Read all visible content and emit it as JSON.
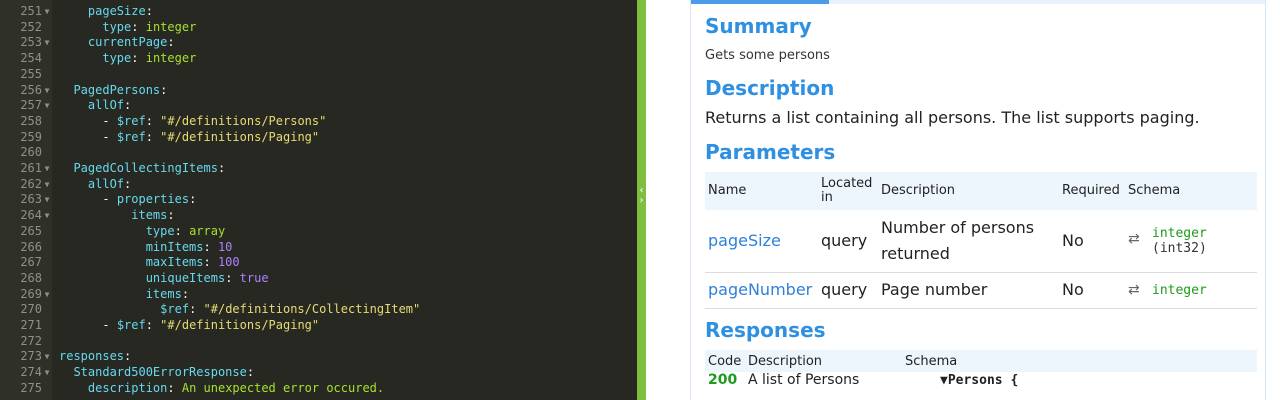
{
  "editor": {
    "lines": [
      {
        "num": "251",
        "fold": true,
        "indent": "    ",
        "tokens": [
          {
            "t": "pageSize",
            "c": "k"
          },
          {
            "t": ":",
            "c": "w"
          }
        ]
      },
      {
        "num": "252",
        "fold": false,
        "indent": "      ",
        "tokens": [
          {
            "t": "type",
            "c": "k"
          },
          {
            "t": ": ",
            "c": "w"
          },
          {
            "t": "integer",
            "c": "g"
          }
        ]
      },
      {
        "num": "253",
        "fold": true,
        "indent": "    ",
        "tokens": [
          {
            "t": "currentPage",
            "c": "k"
          },
          {
            "t": ":",
            "c": "w"
          }
        ]
      },
      {
        "num": "254",
        "fold": false,
        "indent": "      ",
        "tokens": [
          {
            "t": "type",
            "c": "k"
          },
          {
            "t": ": ",
            "c": "w"
          },
          {
            "t": "integer",
            "c": "g"
          }
        ]
      },
      {
        "num": "255",
        "fold": false,
        "indent": "",
        "tokens": []
      },
      {
        "num": "256",
        "fold": true,
        "indent": "  ",
        "tokens": [
          {
            "t": "PagedPersons",
            "c": "k"
          },
          {
            "t": ":",
            "c": "w"
          }
        ]
      },
      {
        "num": "257",
        "fold": true,
        "indent": "    ",
        "tokens": [
          {
            "t": "allOf",
            "c": "k"
          },
          {
            "t": ":",
            "c": "w"
          }
        ]
      },
      {
        "num": "258",
        "fold": false,
        "indent": "      ",
        "tokens": [
          {
            "t": "- ",
            "c": "w"
          },
          {
            "t": "$ref",
            "c": "k"
          },
          {
            "t": ": ",
            "c": "w"
          },
          {
            "t": "\"#/definitions/Persons\"",
            "c": "s"
          }
        ]
      },
      {
        "num": "259",
        "fold": false,
        "indent": "      ",
        "tokens": [
          {
            "t": "- ",
            "c": "w"
          },
          {
            "t": "$ref",
            "c": "k"
          },
          {
            "t": ": ",
            "c": "w"
          },
          {
            "t": "\"#/definitions/Paging\"",
            "c": "s"
          }
        ]
      },
      {
        "num": "260",
        "fold": false,
        "indent": "",
        "tokens": []
      },
      {
        "num": "261",
        "fold": true,
        "indent": "  ",
        "tokens": [
          {
            "t": "PagedCollectingItems",
            "c": "k"
          },
          {
            "t": ":",
            "c": "w"
          }
        ]
      },
      {
        "num": "262",
        "fold": true,
        "indent": "    ",
        "tokens": [
          {
            "t": "allOf",
            "c": "k"
          },
          {
            "t": ":",
            "c": "w"
          }
        ]
      },
      {
        "num": "263",
        "fold": true,
        "indent": "      ",
        "tokens": [
          {
            "t": "- ",
            "c": "w"
          },
          {
            "t": "properties",
            "c": "k"
          },
          {
            "t": ":",
            "c": "w"
          }
        ]
      },
      {
        "num": "264",
        "fold": true,
        "indent": "          ",
        "tokens": [
          {
            "t": "items",
            "c": "k"
          },
          {
            "t": ":",
            "c": "w"
          }
        ]
      },
      {
        "num": "265",
        "fold": false,
        "indent": "            ",
        "tokens": [
          {
            "t": "type",
            "c": "k"
          },
          {
            "t": ": ",
            "c": "w"
          },
          {
            "t": "array",
            "c": "g"
          }
        ]
      },
      {
        "num": "266",
        "fold": false,
        "indent": "            ",
        "tokens": [
          {
            "t": "minItems",
            "c": "k"
          },
          {
            "t": ": ",
            "c": "w"
          },
          {
            "t": "10",
            "c": "n"
          }
        ]
      },
      {
        "num": "267",
        "fold": false,
        "indent": "            ",
        "tokens": [
          {
            "t": "maxItems",
            "c": "k"
          },
          {
            "t": ": ",
            "c": "w"
          },
          {
            "t": "100",
            "c": "n"
          }
        ]
      },
      {
        "num": "268",
        "fold": false,
        "indent": "            ",
        "tokens": [
          {
            "t": "uniqueItems",
            "c": "k"
          },
          {
            "t": ": ",
            "c": "w"
          },
          {
            "t": "true",
            "c": "n"
          }
        ]
      },
      {
        "num": "269",
        "fold": true,
        "indent": "            ",
        "tokens": [
          {
            "t": "items",
            "c": "k"
          },
          {
            "t": ":",
            "c": "w"
          }
        ]
      },
      {
        "num": "270",
        "fold": false,
        "indent": "              ",
        "tokens": [
          {
            "t": "$ref",
            "c": "k"
          },
          {
            "t": ": ",
            "c": "w"
          },
          {
            "t": "\"#/definitions/CollectingItem\"",
            "c": "s"
          }
        ]
      },
      {
        "num": "271",
        "fold": false,
        "indent": "      ",
        "tokens": [
          {
            "t": "- ",
            "c": "w"
          },
          {
            "t": "$ref",
            "c": "k"
          },
          {
            "t": ": ",
            "c": "w"
          },
          {
            "t": "\"#/definitions/Paging\"",
            "c": "s"
          }
        ]
      },
      {
        "num": "272",
        "fold": false,
        "indent": "",
        "tokens": []
      },
      {
        "num": "273",
        "fold": true,
        "indent": "",
        "tokens": [
          {
            "t": "responses",
            "c": "k"
          },
          {
            "t": ":",
            "c": "w"
          }
        ]
      },
      {
        "num": "274",
        "fold": true,
        "indent": "  ",
        "tokens": [
          {
            "t": "Standard500ErrorResponse",
            "c": "k"
          },
          {
            "t": ":",
            "c": "w"
          }
        ]
      },
      {
        "num": "275",
        "fold": false,
        "indent": "    ",
        "tokens": [
          {
            "t": "description",
            "c": "k"
          },
          {
            "t": ": ",
            "c": "w"
          },
          {
            "t": "An unexpected error occured.",
            "c": "g"
          }
        ]
      }
    ]
  },
  "preview": {
    "summary_heading": "Summary",
    "summary_text": "Gets some persons",
    "description_heading": "Description",
    "description_text": "Returns a list containing all persons. The list supports paging.",
    "parameters_heading": "Parameters",
    "param_columns": {
      "name": "Name",
      "located_in": "Located in",
      "description": "Description",
      "required": "Required",
      "schema": "Schema"
    },
    "params": [
      {
        "name": "pageSize",
        "in": "query",
        "description": "Number of persons returned",
        "required": "No",
        "type": "integer",
        "format": "(int32)"
      },
      {
        "name": "pageNumber",
        "in": "query",
        "description": "Page number",
        "required": "No",
        "type": "integer",
        "format": ""
      }
    ],
    "responses_heading": "Responses",
    "response_columns": {
      "code": "Code",
      "description": "Description",
      "schema": "Schema"
    },
    "responses": [
      {
        "code": "200",
        "description": "A list of Persons",
        "schema": "▼Persons {"
      }
    ]
  },
  "colors": {
    "editor_bg": "#272822",
    "splitter": "#7fbf3f",
    "heading_blue": "#2f8fe0",
    "link_blue": "#2f80d8",
    "type_green": "#1c9b1c"
  },
  "icons": {
    "fold": "fold-arrow-icon",
    "schema_swap": "swap-arrows-icon",
    "splitter_handle": "collapse-arrows-icon"
  }
}
